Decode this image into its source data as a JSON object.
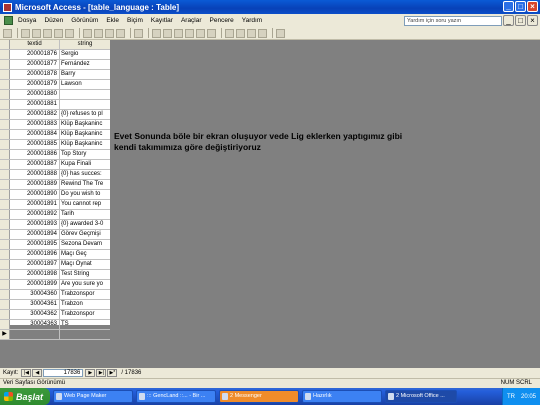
{
  "window": {
    "title": "Microsoft Access - [table_language : Table]"
  },
  "menu": [
    "Dosya",
    "Düzen",
    "Görünüm",
    "Ekle",
    "Biçim",
    "Kayıtlar",
    "Araçlar",
    "Pencere",
    "Yardım"
  ],
  "help_placeholder": "Yardım için soru yazın",
  "table": {
    "columns": [
      "textid",
      "string"
    ],
    "rows": [
      [
        "200001876",
        "Sergio"
      ],
      [
        "200001877",
        "Fernández"
      ],
      [
        "200001878",
        "Barry"
      ],
      [
        "200001879",
        "Lawson"
      ],
      [
        "200001880",
        ""
      ],
      [
        "200001881",
        ""
      ],
      [
        "200001882",
        "{0} refuses to pl"
      ],
      [
        "200001883",
        "Klüp Başkaninc"
      ],
      [
        "200001884",
        "Klüp Başkaninc"
      ],
      [
        "200001885",
        "Klüp Başkaninc"
      ],
      [
        "200001886",
        "Top Story"
      ],
      [
        "200001887",
        "Kupa Finali"
      ],
      [
        "200001888",
        "{0} has succes:"
      ],
      [
        "200001889",
        "Rewind The Tre"
      ],
      [
        "200001890",
        "Do you wish to"
      ],
      [
        "200001891",
        "You cannot rep"
      ],
      [
        "200001892",
        "Tarih"
      ],
      [
        "200001893",
        "{0} awarded 3-0"
      ],
      [
        "200001894",
        "Görev Geçmişi"
      ],
      [
        "200001895",
        "Sezona Devam"
      ],
      [
        "200001896",
        "Maçı Geç"
      ],
      [
        "200001897",
        "Maçı Oynat"
      ],
      [
        "200001898",
        "Test String"
      ],
      [
        "200001899",
        "Are you sure yo"
      ],
      [
        "30004360",
        "Trabzonspor"
      ],
      [
        "30004361",
        "Trabzon"
      ],
      [
        "30004362",
        "Trabzonspor"
      ],
      [
        "30004363",
        "TS"
      ]
    ],
    "new_row_marker": "▶"
  },
  "annotation": "Evet Sonunda böle bir ekran oluşuyor vede Lig eklerken yaptıgımız gibi kendi takımımıza göre değiştiriyoruz",
  "navigation": {
    "label": "Kayıt:",
    "current": "17836",
    "total_label": "/ 17836"
  },
  "status": {
    "left": "Veri Sayfası Görünümü",
    "right": "NUM  SCRL"
  },
  "taskbar": {
    "start": "Başlat",
    "tasks": [
      "Web Page Maker",
      "::: GencLand ::... - Bir ...",
      "2 Messenger",
      "Hazırlık",
      "2 Microsoft Office ..."
    ],
    "lang": "TR",
    "clock": "20:05"
  },
  "colors": {
    "titlebar": "#0841b8",
    "workspace": "#808080",
    "taskbar": "#245edb",
    "start": "#2e8b2e"
  }
}
